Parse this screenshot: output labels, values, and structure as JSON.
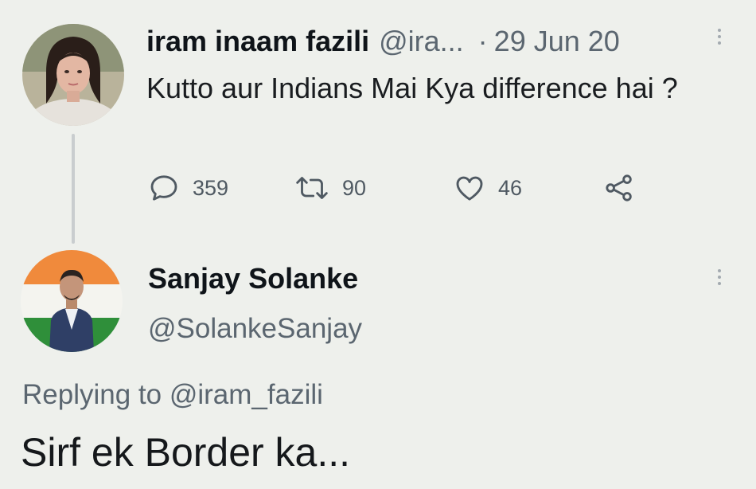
{
  "tweet1": {
    "author_name": "iram inaam fazili",
    "author_handle": "@ira...",
    "separator": "·",
    "date": "29 Jun 20",
    "text": "Kutto aur Indians Mai Kya difference hai ?",
    "actions": {
      "reply_count": "359",
      "retweet_count": "90",
      "like_count": "46"
    },
    "icons": [
      "reply-icon",
      "retweet-icon",
      "like-icon",
      "share-icon",
      "more-icon"
    ]
  },
  "tweet2": {
    "author_name": "Sanjay Solanke",
    "author_handle": "@SolankeSanjay",
    "replying_prefix": "Replying to",
    "replying_mention": "@iram_fazili",
    "text": "Sirf ek Border ka..."
  },
  "colors": {
    "background": "#eef0ec",
    "text_primary": "#0f1419",
    "text_secondary": "#5b6670",
    "thread_line": "#c9cdcf",
    "flag_saffron": "#f08a3c",
    "flag_green": "#2f8f3a"
  }
}
